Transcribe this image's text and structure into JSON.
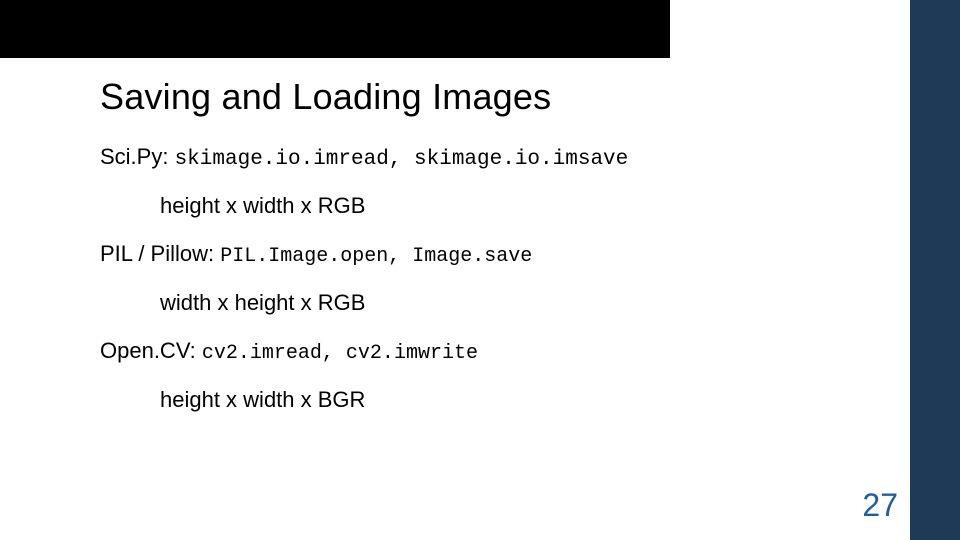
{
  "title": "Saving and Loading Images",
  "lines": {
    "scipy_label": "Sci.Py:  ",
    "scipy_code": "skimage.io.imread, skimage.io.imsave",
    "scipy_dim": "height x width x RGB",
    "pil_label": "PIL / Pillow: ",
    "pil_code": "PIL.Image.open, Image.save",
    "pil_dim": "width x height x RGB",
    "opencv_label": "Open.CV: ",
    "opencv_code": "cv2.imread, cv2.imwrite",
    "opencv_dim": "height x width x BGR"
  },
  "page_number": "27"
}
